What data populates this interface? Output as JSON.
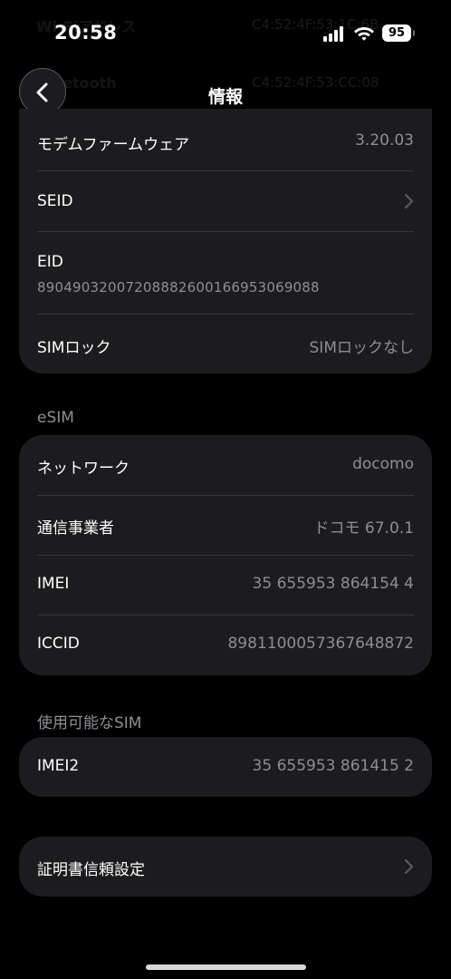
{
  "status_bar": {
    "time": "20:58",
    "battery": "95"
  },
  "background_rows": [
    {
      "label": "Wi-Fiアドレス",
      "value": "C4:52:4F:53:1C:6B"
    },
    {
      "label": "Bluetooth",
      "value": "C4:52:4F:53:CC:08"
    }
  ],
  "nav": {
    "title": "情報"
  },
  "group1": {
    "modem_label": "モデムファームウェア",
    "modem_value": "3.20.03",
    "seid_label": "SEID",
    "eid_label": "EID",
    "eid_value": "89049032007208882600166953069088",
    "simlock_label": "SIMロック",
    "simlock_value": "SIMロックなし"
  },
  "esim": {
    "header": "eSIM",
    "rows": [
      {
        "label": "ネットワーク",
        "value": "docomo"
      },
      {
        "label": "通信事業者",
        "value": "ドコモ 67.0.1"
      },
      {
        "label": "IMEI",
        "value": "35 655953 864154 4"
      },
      {
        "label": "ICCID",
        "value": "8981100057367648872"
      }
    ]
  },
  "available_sim": {
    "header": "使用可能なSIM",
    "rows": [
      {
        "label": "IMEI2",
        "value": "35 655953 861415 2"
      }
    ]
  },
  "certificate": {
    "label": "証明書信頼設定"
  },
  "colors": {
    "background": "#000000",
    "card": "#1c1c1e",
    "secondary_text": "#8e8e93",
    "separator": "#38383a"
  }
}
